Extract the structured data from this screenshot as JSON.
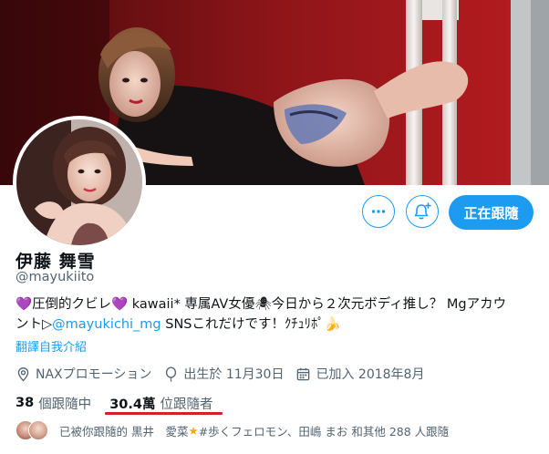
{
  "profile": {
    "display_name": "伊藤 舞雪",
    "handle": "@mayukiito",
    "bio": {
      "heart1": "💜",
      "seg1": "圧倒的クビレ",
      "heart2": "💜",
      "seg2": " kawaii* 専属AV女優",
      "spider": "🕷",
      "seg3": "今日から２次元ボディ推し？ Mgアカウ",
      "line2_seg1": "ント▷",
      "link": "@mayukichi_mg",
      "line2_seg2": " SNSこれだけです！ｸﾁｭﾘﾎﾟ",
      "banana": "🍌"
    },
    "translate_label": "翻譯自我介紹",
    "meta": {
      "location": "NAXプロモーション",
      "birthday": "出生於 11月30日",
      "joined": "已加入 2018年8月"
    },
    "following_count": "38",
    "following_label": "個跟隨中",
    "followers_count": "30.4萬",
    "followers_label": "位跟隨者",
    "followed_by": {
      "prefix": "已被你跟隨的 黒井　愛菜",
      "star": "★",
      "suffix": "#歩くフェロモン、田嶋 まお 和其他 288 人跟隨"
    }
  },
  "actions": {
    "more_icon": "more-icon",
    "notify_icon": "bell-plus-icon",
    "follow_label": "正在跟隨"
  },
  "colors": {
    "accent": "#1d9bf0",
    "text": "#0f1419",
    "secondary": "#536471",
    "underline": "#d81e2a",
    "banner_red": "#a9191d"
  }
}
